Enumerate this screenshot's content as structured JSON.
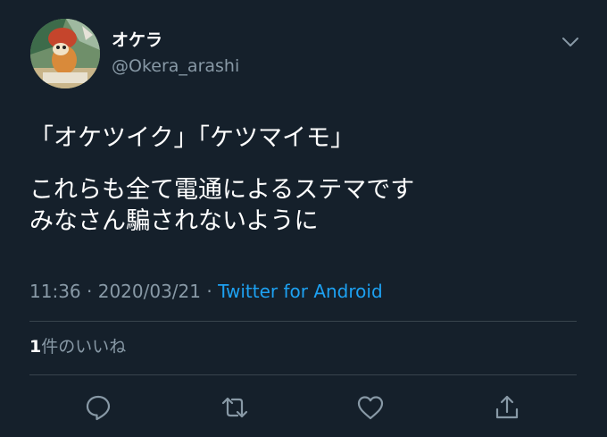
{
  "tweet": {
    "author": {
      "display_name": "オケラ",
      "handle": "@Okera_arashi"
    },
    "text_lines": [
      "「オケツイク」「ケツマイモ」",
      "これらも全て電通によるステマです",
      "みなさん騙されないように"
    ],
    "time": "11:36",
    "separator": "·",
    "date": "2020/03/21",
    "source": "Twitter for Android",
    "likes": {
      "count": "1",
      "label": "件のいいね"
    }
  },
  "actions": {
    "icons": [
      "reply-icon",
      "retweet-icon",
      "like-icon",
      "share-icon"
    ]
  },
  "colors": {
    "background": "#15202b",
    "text": "#ffffff",
    "secondary": "#8899a6",
    "link": "#1da1f2",
    "divider": "#38444d"
  }
}
